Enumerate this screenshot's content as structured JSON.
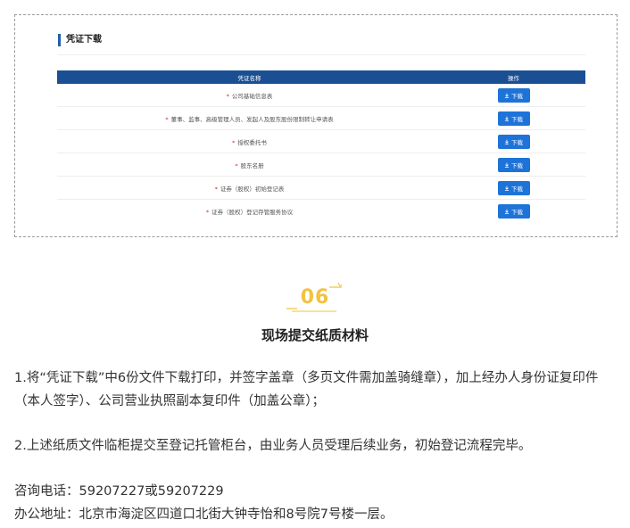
{
  "panel": {
    "title": "凭证下载",
    "columns": {
      "name": "凭证名称",
      "action": "操作"
    },
    "required_mark": "*",
    "download_label": "下载",
    "rows": [
      {
        "name": "公司基础信息表"
      },
      {
        "name": "董事、监事、高级管理人员、发起人及股东股份限制转让申请表"
      },
      {
        "name": "授权委托书"
      },
      {
        "name": "股东名册"
      },
      {
        "name": "证券（股权）初始登记表"
      },
      {
        "name": "证券（股权）登记存管服务协议"
      }
    ]
  },
  "step": {
    "number": "06",
    "title": "现场提交纸质材料"
  },
  "paragraphs": {
    "p1": "1.将“凭证下载”中6份文件下载打印，并签字盖章（多页文件需加盖骑缝章），加上经办人身份证复印件（本人签字）、公司营业执照副本复印件（加盖公章）；",
    "p2": "2.上述纸质文件临柜提交至登记托管柜台，由业务人员受理后续业务，初始登记流程完毕。"
  },
  "contact": {
    "phone": "咨询电话：59207227或59207229",
    "address": "办公地址：北京市海淀区四道口北街大钟寺怡和8号院7号楼一层。"
  },
  "colors": {
    "header_bg": "#1b4f93",
    "button_bg": "#1d73d8",
    "required": "#e02020",
    "accent_gold": "#f3c242"
  }
}
